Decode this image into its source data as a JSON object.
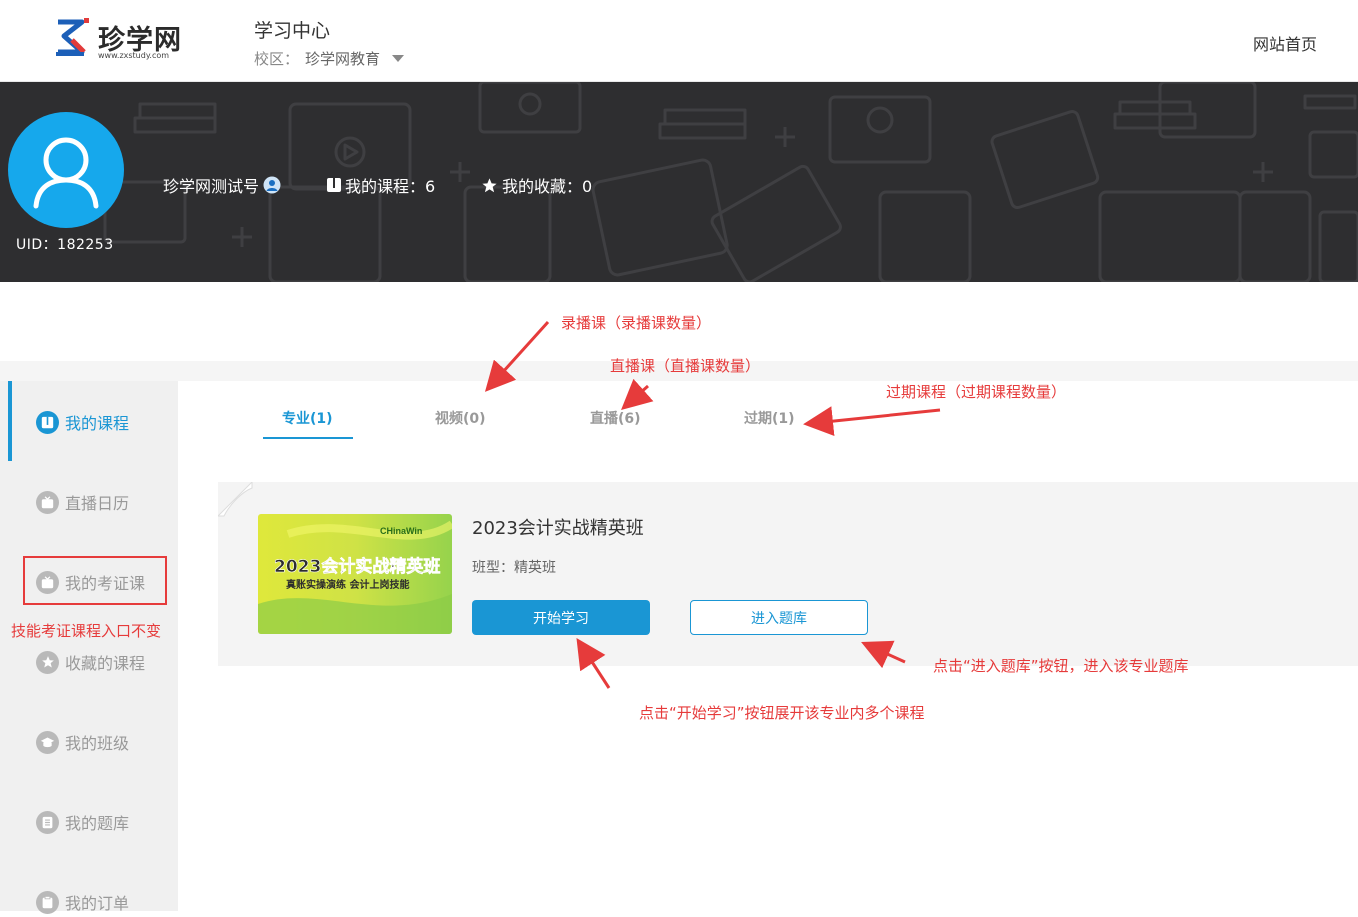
{
  "header": {
    "logo_name": "珍学网",
    "logo_url": "www.zxstudy.com",
    "title": "学习中心",
    "campus_label": "校区：",
    "campus_value": "珍学网教育",
    "home_link": "网站首页"
  },
  "profile": {
    "uid": "UID：182253",
    "username": "珍学网测试号",
    "courses_label": "我的课程：6",
    "favs_label": "我的收藏：0"
  },
  "sidebar": {
    "items": [
      {
        "label": "我的课程",
        "icon": "book-icon",
        "active": true
      },
      {
        "label": "直播日历",
        "icon": "tv-icon",
        "active": false
      },
      {
        "label": "我的考证课",
        "icon": "tv-icon",
        "active": false
      },
      {
        "label": "收藏的课程",
        "icon": "star-icon",
        "active": false
      },
      {
        "label": "我的班级",
        "icon": "graduation-cap-icon",
        "active": false
      },
      {
        "label": "我的题库",
        "icon": "list-icon",
        "active": false
      },
      {
        "label": "我的订单",
        "icon": "clipboard-icon",
        "active": false
      }
    ]
  },
  "tabs": [
    {
      "label": "专业(1)",
      "active": true
    },
    {
      "label": "视频(0)",
      "active": false
    },
    {
      "label": "直播(6)",
      "active": false
    },
    {
      "label": "过期(1)",
      "active": false
    }
  ],
  "course": {
    "title": "2023会计实战精英班",
    "type_label": "班型：",
    "type_value": "精英班",
    "start_button": "开始学习",
    "bank_button": "进入题库",
    "thumb": {
      "brand": "CHinaWin",
      "headline": "2023会计实战精英班",
      "subline": "真账实操演练 会计上岗技能"
    }
  },
  "annotations": {
    "recorded": "录播课（录播课数量）",
    "live": "直播课（直播课数量）",
    "expired": "过期课程（过期课程数量）",
    "cert_entry": "技能考证课程入口不变",
    "bank_note": "点击“进入题库”按钮，进入该专业题库",
    "start_note": "点击“开始学习”按钮展开该专业内多个课程"
  },
  "colors": {
    "accent": "#1a96d4",
    "annotation": "#e63b3b",
    "banner_bg": "#2e2e30",
    "avatar_bg": "#16a8ec"
  }
}
